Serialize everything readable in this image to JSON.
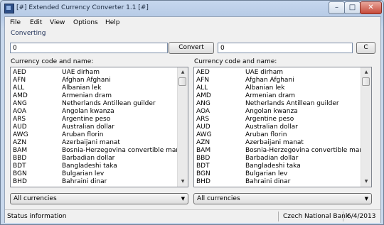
{
  "window": {
    "title": "[#] Extended Currency Converter 1.1 [#]"
  },
  "titlebar_buttons": {
    "minimize": "–",
    "maximize": "□",
    "close": "✕"
  },
  "menu": [
    {
      "label": "File"
    },
    {
      "label": "Edit"
    },
    {
      "label": "View"
    },
    {
      "label": "Options"
    },
    {
      "label": "Help"
    }
  ],
  "converting": {
    "group_label": "Converting",
    "input_value": "0",
    "convert_label": "Convert",
    "output_value": "0",
    "clear_label": "C"
  },
  "left_list": {
    "label": "Currency code and name:",
    "filter": "All currencies",
    "rows": [
      {
        "code": "AED",
        "name": "UAE dirham"
      },
      {
        "code": "AFN",
        "name": "Afghan Afghani"
      },
      {
        "code": "ALL",
        "name": "Albanian lek"
      },
      {
        "code": "AMD",
        "name": "Armenian dram"
      },
      {
        "code": "ANG",
        "name": "Netherlands Antillean guilder"
      },
      {
        "code": "AOA",
        "name": "Angolan kwanza"
      },
      {
        "code": "ARS",
        "name": "Argentine peso"
      },
      {
        "code": "AUD",
        "name": "Australian dollar"
      },
      {
        "code": "AWG",
        "name": "Aruban florin"
      },
      {
        "code": "AZN",
        "name": "Azerbaijani manat"
      },
      {
        "code": "BAM",
        "name": "Bosnia-Herzegovina convertible mark"
      },
      {
        "code": "BBD",
        "name": "Barbadian dollar"
      },
      {
        "code": "BDT",
        "name": "Bangladeshi taka"
      },
      {
        "code": "BGN",
        "name": "Bulgarian lev"
      },
      {
        "code": "BHD",
        "name": "Bahraini dinar"
      }
    ]
  },
  "right_list": {
    "label": "Currency code and name:",
    "filter": "All currencies",
    "rows": [
      {
        "code": "AED",
        "name": "UAE dirham"
      },
      {
        "code": "AFN",
        "name": "Afghan Afghani"
      },
      {
        "code": "ALL",
        "name": "Albanian lek"
      },
      {
        "code": "AMD",
        "name": "Armenian dram"
      },
      {
        "code": "ANG",
        "name": "Netherlands Antillean guilder"
      },
      {
        "code": "AOA",
        "name": "Angolan kwanza"
      },
      {
        "code": "ARS",
        "name": "Argentine peso"
      },
      {
        "code": "AUD",
        "name": "Australian dollar"
      },
      {
        "code": "AWG",
        "name": "Aruban florin"
      },
      {
        "code": "AZN",
        "name": "Azerbaijani manat"
      },
      {
        "code": "BAM",
        "name": "Bosnia-Herzegovina convertible mark"
      },
      {
        "code": "BBD",
        "name": "Barbadian dollar"
      },
      {
        "code": "BDT",
        "name": "Bangladeshi taka"
      },
      {
        "code": "BGN",
        "name": "Bulgarian lev"
      },
      {
        "code": "BHD",
        "name": "Bahraini dinar"
      }
    ]
  },
  "status": {
    "info": "Status information",
    "source": "Czech National Bank",
    "date": "6/4/2013"
  }
}
